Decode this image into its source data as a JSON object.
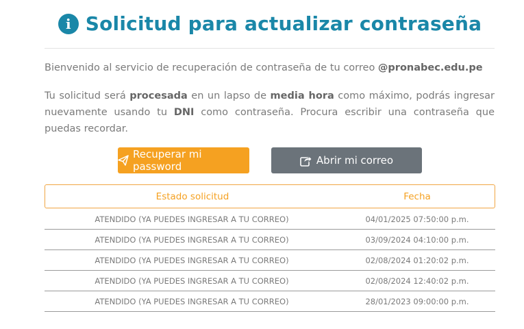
{
  "header": {
    "info_glyph": "i",
    "title": "Solicitud para actualizar contraseña"
  },
  "intro": {
    "text": "Bienvenido al servicio de recuperación de contraseña de tu correo ",
    "domain": "@pronabec.edu.pe"
  },
  "notice": {
    "t1": "Tu solicitud será ",
    "b1": "procesada",
    "t2": " en un lapso de ",
    "b2": "media hora",
    "t3": " como máximo, podrás ingresar nuevamente usando tu ",
    "b3": "DNI",
    "t4": " como contraseña. Procura escribir una contraseña que puedas recordar."
  },
  "buttons": {
    "recover_label": "Recuperar mi password",
    "recover_icon": "paper-plane-icon",
    "recover_color": "#f5a121",
    "mail_label": "Abrir mi correo",
    "mail_icon": "share-square-icon",
    "mail_color": "#6b737a"
  },
  "table": {
    "headers": [
      "Estado solicitud",
      "Fecha"
    ],
    "rows": [
      {
        "status": "ATENDIDO (YA PUEDES INGRESAR A TU CORREO)",
        "date": "04/01/2025 07:50:00 p.m."
      },
      {
        "status": "ATENDIDO (YA PUEDES INGRESAR A TU CORREO)",
        "date": "03/09/2024 04:10:00 p.m."
      },
      {
        "status": "ATENDIDO (YA PUEDES INGRESAR A TU CORREO)",
        "date": "02/08/2024 01:20:02 p.m."
      },
      {
        "status": "ATENDIDO (YA PUEDES INGRESAR A TU CORREO)",
        "date": "02/08/2024 12:40:02 p.m."
      },
      {
        "status": "ATENDIDO (YA PUEDES INGRESAR A TU CORREO)",
        "date": "28/01/2023 09:00:00 p.m."
      }
    ]
  },
  "colors": {
    "title": "#1a87a8",
    "accent": "#f5a121",
    "secondary": "#6b737a"
  }
}
